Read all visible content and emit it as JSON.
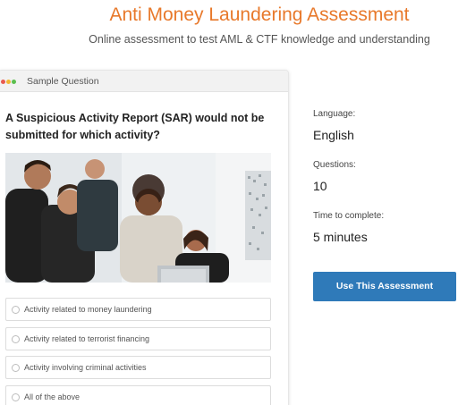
{
  "header": {
    "title": "Anti Money Laundering Assessment",
    "subtitle": "Online assessment to test AML & CTF knowledge and understanding"
  },
  "card": {
    "window_label": "Sample Question",
    "question": "A Suspicious Activity Report (SAR) would not be submitted for which activity?",
    "options": [
      "Activity related to money laundering",
      "Activity related to terrorist financing",
      "Activity involving criminal activities",
      "All of the above"
    ]
  },
  "details": {
    "language_label": "Language:",
    "language_value": "English",
    "questions_label": "Questions:",
    "questions_value": "10",
    "time_label": "Time to complete:",
    "time_value": "5 minutes"
  },
  "actions": {
    "use_button": "Use This Assessment"
  },
  "colors": {
    "title": "#e8792b",
    "button": "#2f7ab9"
  }
}
